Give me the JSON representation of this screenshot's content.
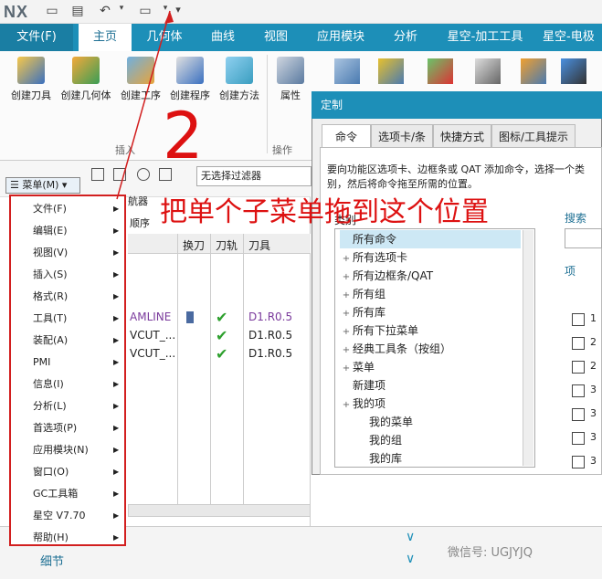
{
  "qat": {
    "logo": "NX"
  },
  "tabs": [
    {
      "label": "文件(F)"
    },
    {
      "label": "主页"
    },
    {
      "label": "几何体"
    },
    {
      "label": "曲线"
    },
    {
      "label": "视图"
    },
    {
      "label": "应用模块"
    },
    {
      "label": "分析"
    },
    {
      "label": "星空-加工工具"
    },
    {
      "label": "星空-电极"
    }
  ],
  "ribbon": {
    "buttons": [
      {
        "label": "创建刀具"
      },
      {
        "label": "创建几何体"
      },
      {
        "label": "创建工序"
      },
      {
        "label": "创建程序"
      },
      {
        "label": "创建方法"
      },
      {
        "label": "属性"
      }
    ],
    "group_insert": "插入",
    "group_ops": "操作"
  },
  "toolbar2": {
    "menu_button": "菜单(M)",
    "filter": "无选择过滤器"
  },
  "navigator": {
    "label_nav": "航器",
    "label_order": "顺序",
    "columns": [
      "换刀",
      "刀轨",
      "刀具"
    ],
    "rows": [
      {
        "name": "AMLINE",
        "tool": "D1.R0.5"
      },
      {
        "name": "VCUT_...",
        "tool": "D1.R0.5"
      },
      {
        "name": "VCUT_...",
        "tool": "D1.R0.5"
      }
    ],
    "detail": "细节"
  },
  "menu": {
    "items": [
      {
        "label": "文件(F)"
      },
      {
        "label": "编辑(E)"
      },
      {
        "label": "视图(V)"
      },
      {
        "label": "插入(S)"
      },
      {
        "label": "格式(R)"
      },
      {
        "label": "工具(T)"
      },
      {
        "label": "装配(A)"
      },
      {
        "label": "PMI"
      },
      {
        "label": "信息(I)"
      },
      {
        "label": "分析(L)"
      },
      {
        "label": "首选项(P)"
      },
      {
        "label": "应用模块(N)"
      },
      {
        "label": "窗口(O)"
      },
      {
        "label": "GC工具箱"
      },
      {
        "label": "星空 V7.70"
      },
      {
        "label": "帮助(H)"
      }
    ]
  },
  "dialog": {
    "title": "定制",
    "tabs": [
      "命令",
      "选项卡/条",
      "快捷方式",
      "图标/工具提示"
    ],
    "description": "要向功能区选项卡、边框条或 QAT 添加命令，选择一个类别，然后将命令拖至所需的位置。",
    "category_label": "类别",
    "search_label": "搜索",
    "items_label": "项",
    "tree": [
      {
        "label": "所有命令",
        "sel": true,
        "level": 0,
        "plus": false
      },
      {
        "label": "所有选项卡",
        "level": 0,
        "plus": true
      },
      {
        "label": "所有边框条/QAT",
        "level": 0,
        "plus": true
      },
      {
        "label": "所有组",
        "level": 0,
        "plus": true
      },
      {
        "label": "所有库",
        "level": 0,
        "plus": true
      },
      {
        "label": "所有下拉菜单",
        "level": 0,
        "plus": true
      },
      {
        "label": "经典工具条（按组）",
        "level": 0,
        "plus": true
      },
      {
        "label": "菜单",
        "level": 0,
        "plus": true
      },
      {
        "label": "新建项",
        "level": 0,
        "plus": false
      },
      {
        "label": "我的项",
        "level": 0,
        "plus": true
      },
      {
        "label": "我的菜单",
        "level": 1,
        "plus": false
      },
      {
        "label": "我的组",
        "level": 1,
        "plus": false
      },
      {
        "label": "我的库",
        "level": 1,
        "plus": false
      }
    ],
    "side_items": [
      "1",
      "2",
      "2",
      "3",
      "3",
      "3",
      "3"
    ]
  },
  "annotation": {
    "text": "把单个子菜单拖到这个位置",
    "number": "2"
  },
  "watermark": "微信号: UGJYJQ",
  "colors": {
    "accent": "#1d8fb8",
    "annotation": "#d21f1f"
  }
}
